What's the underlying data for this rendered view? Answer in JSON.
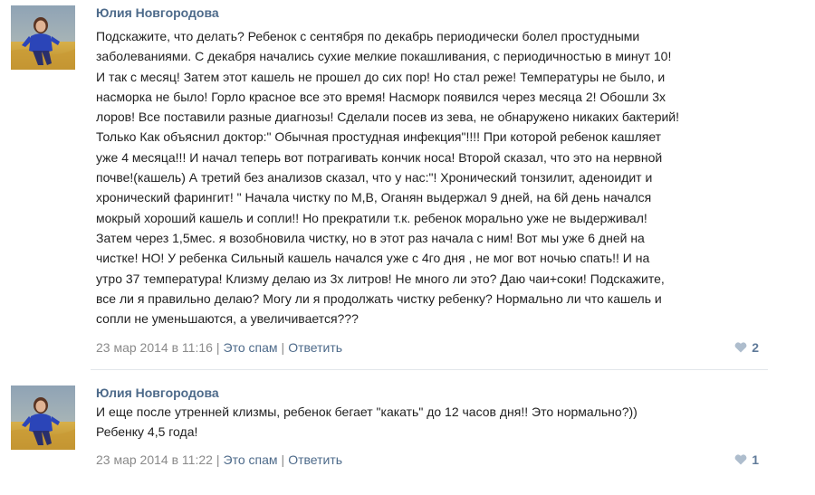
{
  "comments": [
    {
      "author": "Юлия Новгородова",
      "text": "Подскажите, что делать? Ребенок с сентября по декабрь периодически болел простудными\nзаболеваниями. С декабря начались сухие мелкие покашливания, с периодичностью в минут 10!\nИ так с месяц! Затем этот кашель не прошел до сих пор! Но стал реже! Температуры не было, и\nнасморка не было! Горло красное все это время! Насморк появился через месяца 2! Обошли 3х\nлоров! Все поставили разные диагнозы! Сделали посев из зева, не обнаружено никаких бактерий!\nТолько Как объяснил доктор:\" Обычная простудная инфекция\"!!!! При которой ребенок кашляет\nуже 4 месяца!!! И начал теперь вот потрагивать кончик носа! Второй сказал, что это на нервной\nпочве!(кашель) А третий без анализов сказал, что у нас:\"! Хронический тонзилит, аденоидит и\nхронический фарингит! \" Начала чистку по М,В, Оганян выдержал 9 дней, на 6й день начался\nмокрый хороший кашель и сопли!! Но прекратили т.к. ребенок морально уже не выдерживал!\nЗатем через 1,5мес. я возобновила чистку, но в этот раз начала с ним! Вот мы уже 6 дней на\nчистке! НО! У ребенка Сильный кашель начался уже с 4го дня , не мог вот ночью спать!! И на\nутро 37 температура! Клизму делаю из 3х литров! Не много ли это? Даю чаи+соки! Подскажите,\nвсе ли я правильно делаю? Могу ли я продолжать чистку ребенку? Нормально ли что кашель и\nсопли не уменьшаются, а увеличивается???",
      "date": "23 мар 2014 в 11:16",
      "spam_label": "Это спам",
      "reply_label": "Ответить",
      "likes": "2"
    },
    {
      "author": "Юлия Новгородова",
      "text": "И еще после утренней клизмы, ребенок бегает \"какать\" до 12 часов дня!! Это нормально?))\nРебенку 4,5 года!",
      "date": "23 мар 2014 в 11:22",
      "spam_label": "Это спам",
      "reply_label": "Ответить",
      "likes": "1"
    }
  ],
  "icons": {
    "like": "heart-icon",
    "avatar": "user-avatar-photo"
  },
  "colors": {
    "link": "#4d6a8a",
    "meta": "#8a8a8a",
    "text": "#1f1f1f",
    "divider": "#e2e6ea"
  }
}
